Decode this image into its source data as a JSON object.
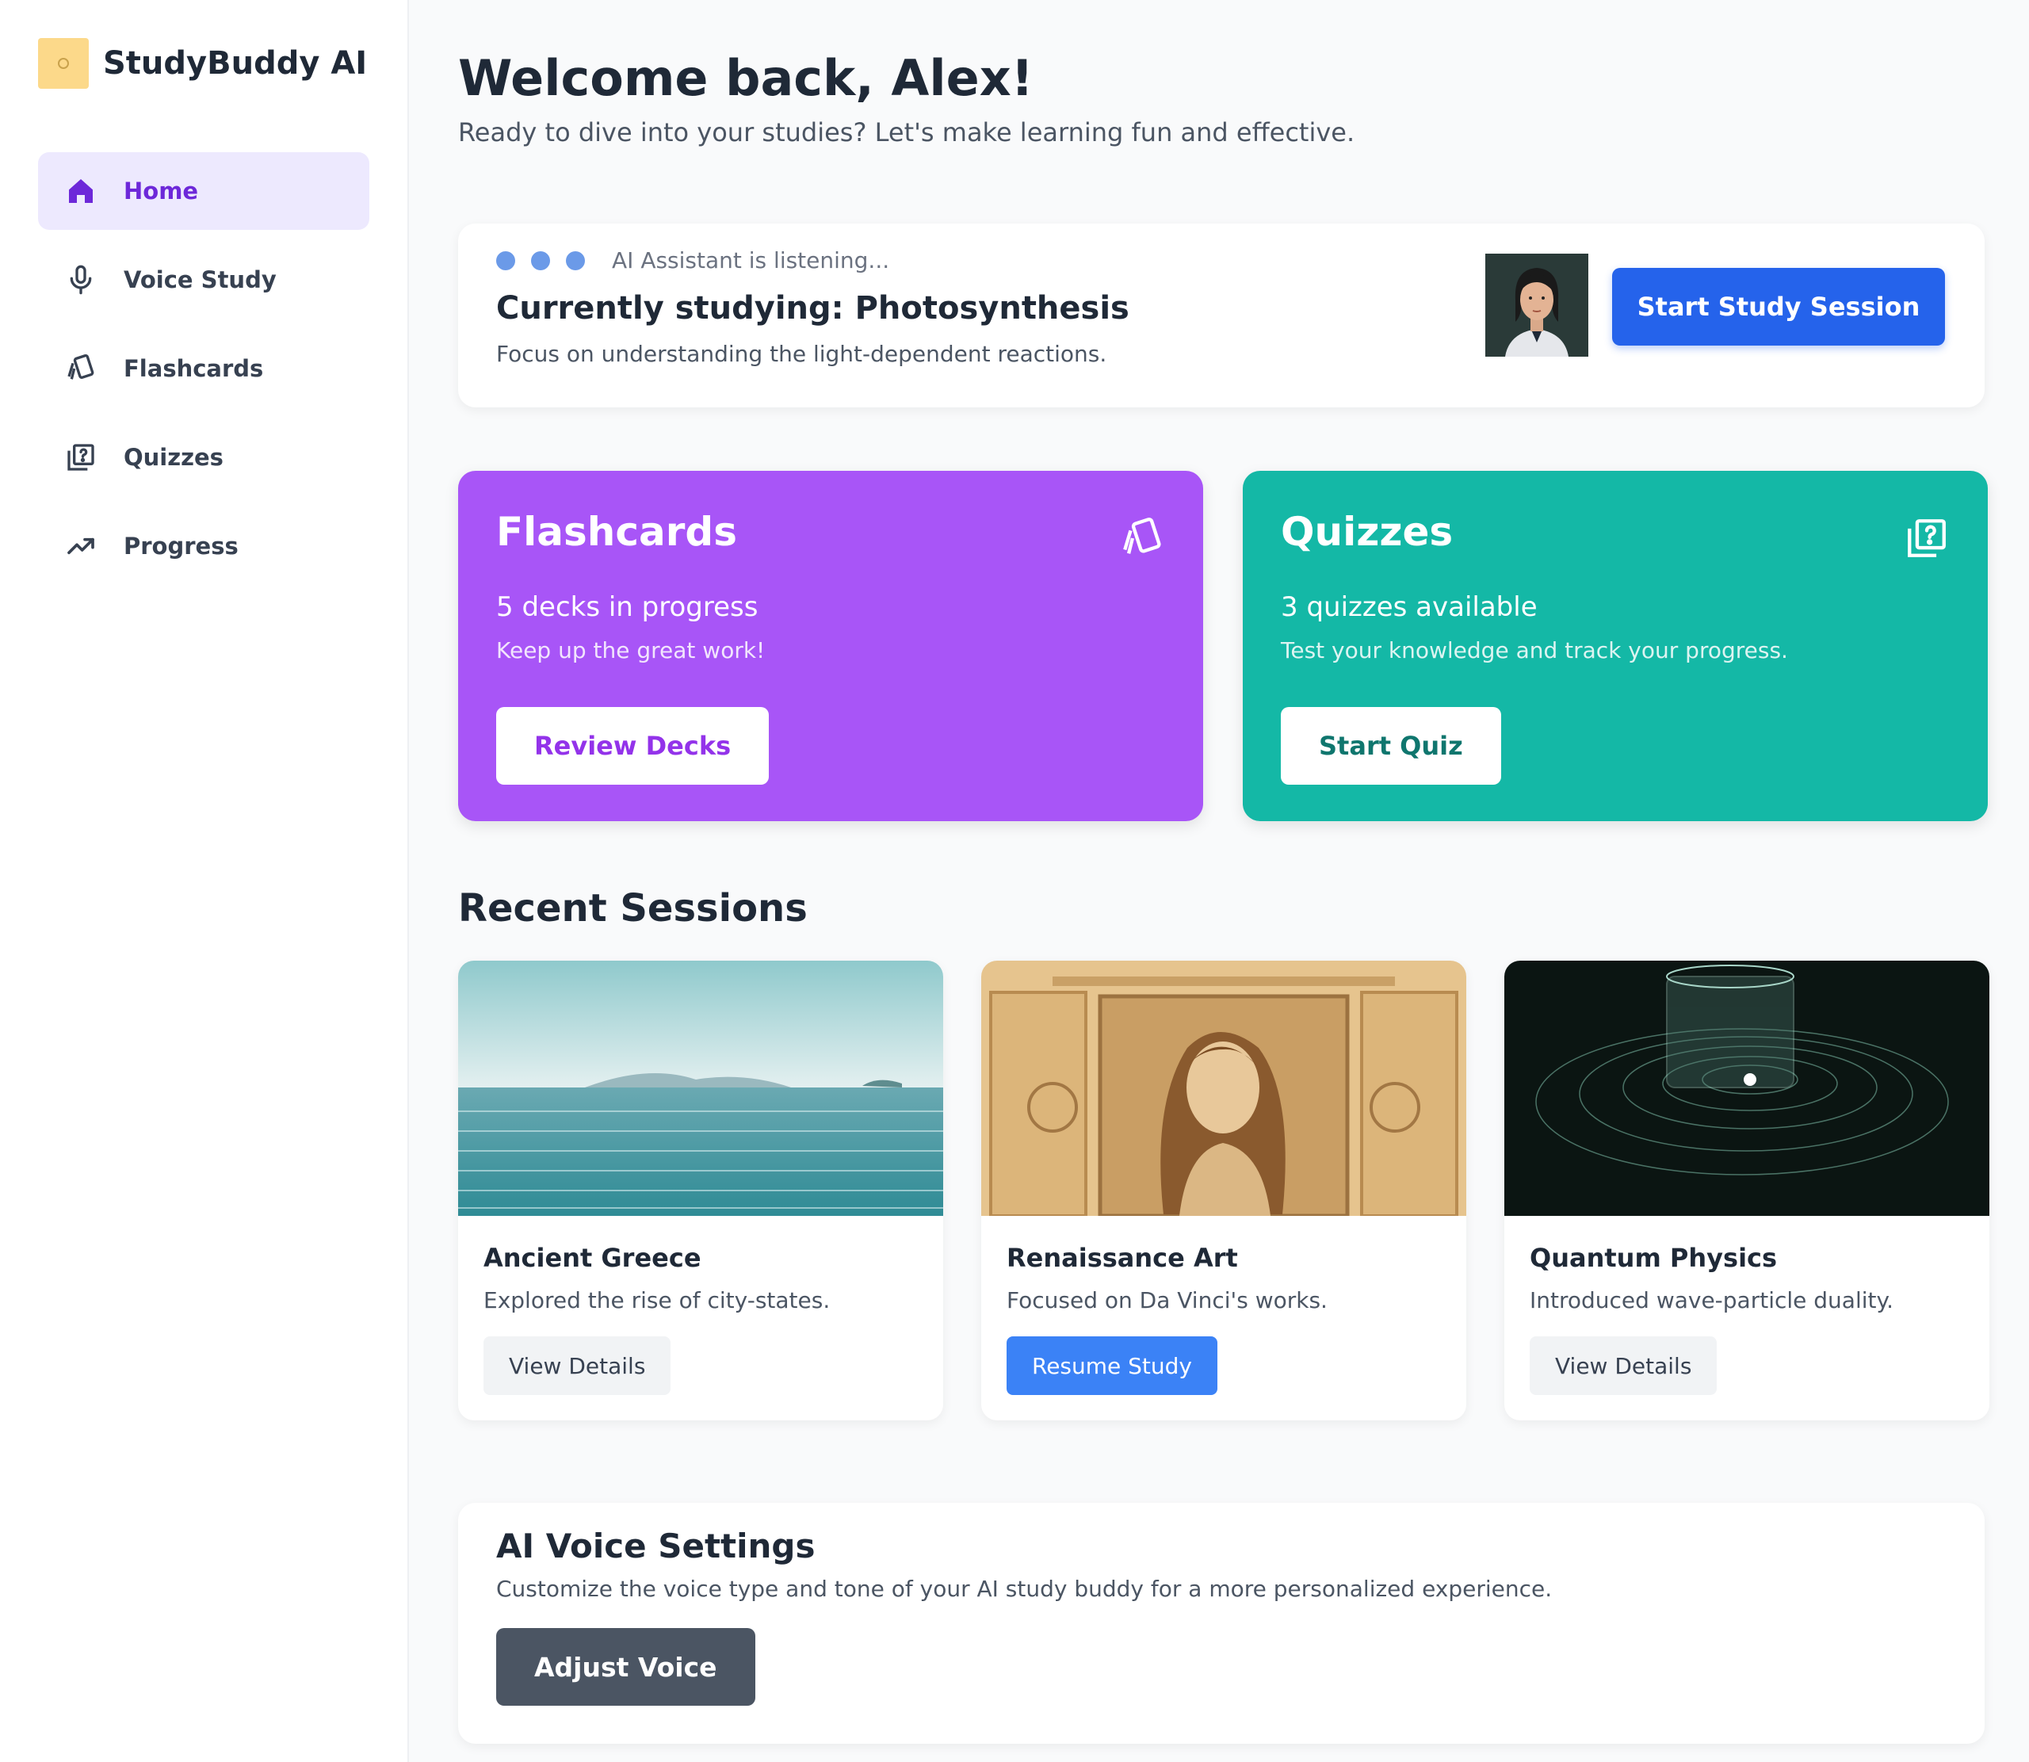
{
  "app": {
    "name": "StudyBuddy AI"
  },
  "sidebar": {
    "items": [
      {
        "label": "Home",
        "icon": "home-icon",
        "active": true
      },
      {
        "label": "Voice Study",
        "icon": "microphone-icon",
        "active": false
      },
      {
        "label": "Flashcards",
        "icon": "flashcards-icon",
        "active": false
      },
      {
        "label": "Quizzes",
        "icon": "quiz-icon",
        "active": false
      },
      {
        "label": "Progress",
        "icon": "trending-up-icon",
        "active": false
      }
    ]
  },
  "header": {
    "title": "Welcome back, Alex!",
    "subtitle": "Ready to dive into your studies? Let's make learning fun and effective."
  },
  "current_study": {
    "status": "AI Assistant is listening...",
    "title": "Currently studying: Photosynthesis",
    "description": "Focus on understanding the light-dependent reactions.",
    "button": "Start Study Session"
  },
  "features": {
    "flashcards": {
      "title": "Flashcards",
      "count": "5 decks in progress",
      "description": "Keep up the great work!",
      "button": "Review Decks",
      "color": "#a855f7"
    },
    "quizzes": {
      "title": "Quizzes",
      "count": "3 quizzes available",
      "description": "Test your knowledge and track your progress.",
      "button": "Start Quiz",
      "color": "#14b8a6"
    }
  },
  "recent": {
    "title": "Recent Sessions",
    "sessions": [
      {
        "title": "Ancient Greece",
        "description": "Explored the rise of city-states.",
        "button": "View Details",
        "image": "sea-landscape"
      },
      {
        "title": "Renaissance Art",
        "description": "Focused on Da Vinci's works.",
        "button": "Resume Study",
        "image": "renaissance-portrait"
      },
      {
        "title": "Quantum Physics",
        "description": "Introduced wave-particle duality.",
        "button": "View Details",
        "image": "quantum-orbit"
      }
    ]
  },
  "voice": {
    "title": "AI Voice Settings",
    "description": "Customize the voice type and tone of your AI study buddy for a more personalized experience.",
    "button": "Adjust Voice"
  },
  "colors": {
    "accent": "#6d28d9",
    "primary": "#2563eb",
    "dark_button": "#4b5563"
  }
}
